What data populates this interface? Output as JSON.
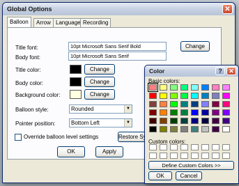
{
  "window": {
    "title": "Global Options",
    "close_glyph": "✕",
    "tabs": [
      "Balloon",
      "Arrow",
      "Language",
      "Recording"
    ],
    "active_tab": "Balloon"
  },
  "form": {
    "title_font_label": "Title font:",
    "title_font_value": "10pt Microsoft Sans Serif Bold",
    "body_font_label": "Body font:",
    "body_font_value": "10pt Microsoft Sans Serif",
    "change_label": "Change",
    "title_color_label": "Title color:",
    "title_color": "#000000",
    "body_color_label": "Body color:",
    "body_color": "#000000",
    "background_color_label": "Background color:",
    "background_color": "#ffffe1",
    "balloon_style_label": "Balloon style:",
    "balloon_style_value": "Rounded",
    "pointer_position_label": "Pointer position:",
    "pointer_position_value": "Bottom Left",
    "override_label": "Override balloon level settings",
    "restore_label": "Restore System"
  },
  "footer": {
    "ok_label": "OK",
    "apply_label": "Apply"
  },
  "color_dialog": {
    "title": "Color",
    "help_glyph": "?",
    "close_glyph": "✕",
    "basic_colors_label": "Basic colors:",
    "custom_colors_label": "Custom colors:",
    "define_label": "Define Custom Colors >>",
    "ok_label": "OK",
    "cancel_label": "Cancel",
    "basic_colors": [
      [
        "#ff8080",
        "#ffff80",
        "#80ff80",
        "#00ff80",
        "#80ffff",
        "#0080ff",
        "#ff80c0",
        "#ff80ff"
      ],
      [
        "#ff0000",
        "#ffff00",
        "#80ff00",
        "#00ff40",
        "#00ffff",
        "#0080c0",
        "#8080c0",
        "#ff00ff"
      ],
      [
        "#804040",
        "#ff8040",
        "#00ff00",
        "#008080",
        "#004080",
        "#8080ff",
        "#800040",
        "#ff0080"
      ],
      [
        "#800000",
        "#ff8000",
        "#008000",
        "#008040",
        "#0000ff",
        "#0000a0",
        "#800080",
        "#8000ff"
      ],
      [
        "#400000",
        "#804000",
        "#004000",
        "#004040",
        "#000080",
        "#000040",
        "#400040",
        "#400080"
      ],
      [
        "#000000",
        "#808000",
        "#808040",
        "#808080",
        "#408080",
        "#c0c0c0",
        "#400040",
        "#ffffff"
      ]
    ],
    "selected_index": 0
  }
}
